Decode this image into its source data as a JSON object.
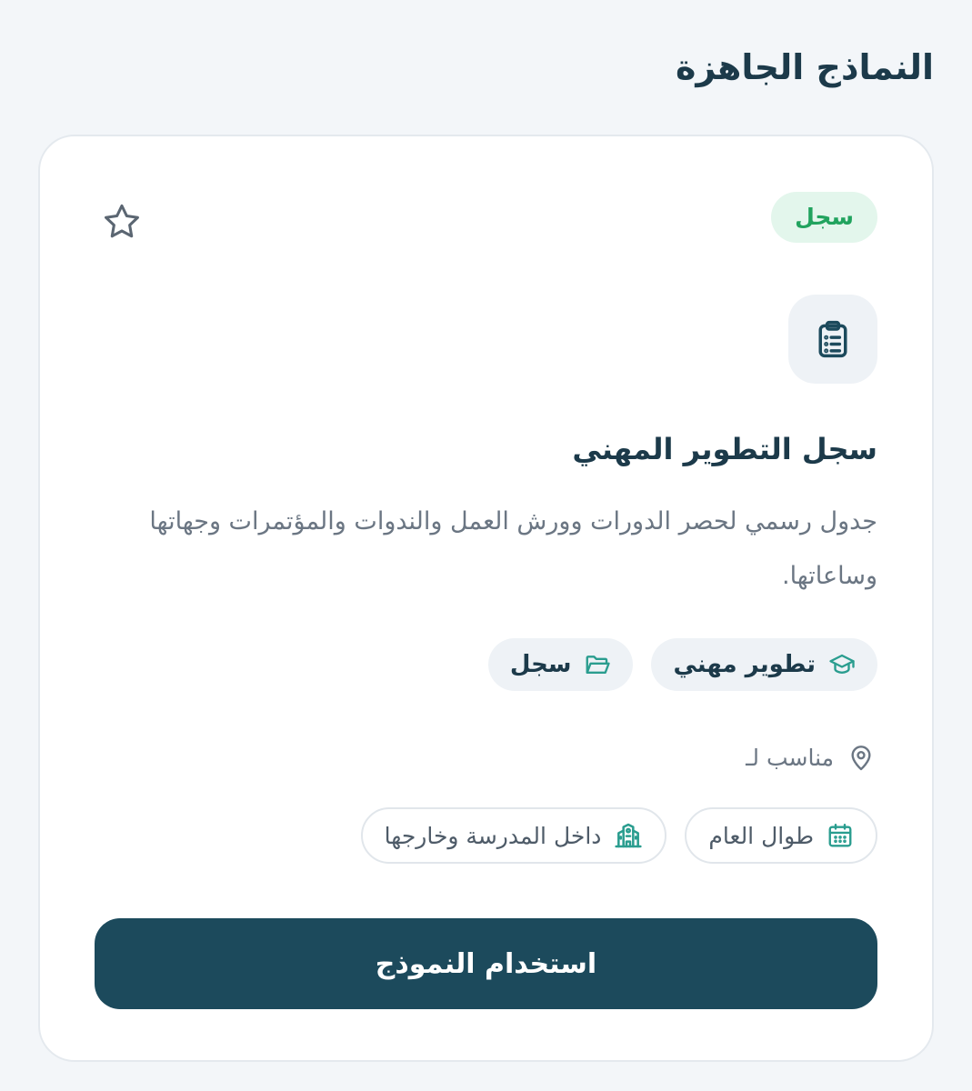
{
  "section": {
    "title": "النماذج الجاهزة"
  },
  "card": {
    "type_badge": "سجل",
    "title": "سجل التطوير المهني",
    "description": "جدول رسمي لحصر الدورات وورش العمل والندوات والمؤتمرات وجهاتها وساعاتها.",
    "tags": [
      {
        "label": "تطوير مهني",
        "icon": "graduation-cap-icon"
      },
      {
        "label": "سجل",
        "icon": "folder-open-icon"
      }
    ],
    "suitable_label": "مناسب لـ",
    "suitable_icon": "map-pin-icon",
    "chips": [
      {
        "label": "طوال العام",
        "icon": "calendar-icon"
      },
      {
        "label": "داخل المدرسة وخارجها",
        "icon": "school-building-icon"
      }
    ],
    "template_icon": "clipboard-list-icon",
    "favorite_icon": "star-icon",
    "use_button_label": "استخدام النموذج"
  },
  "colors": {
    "primary": "#1c4a5c",
    "heading": "#1c3a4a",
    "badge_bg": "#e3f6ec",
    "badge_text": "#21a35e",
    "accent_teal": "#2a9d8f",
    "muted_text": "#6b7683"
  }
}
